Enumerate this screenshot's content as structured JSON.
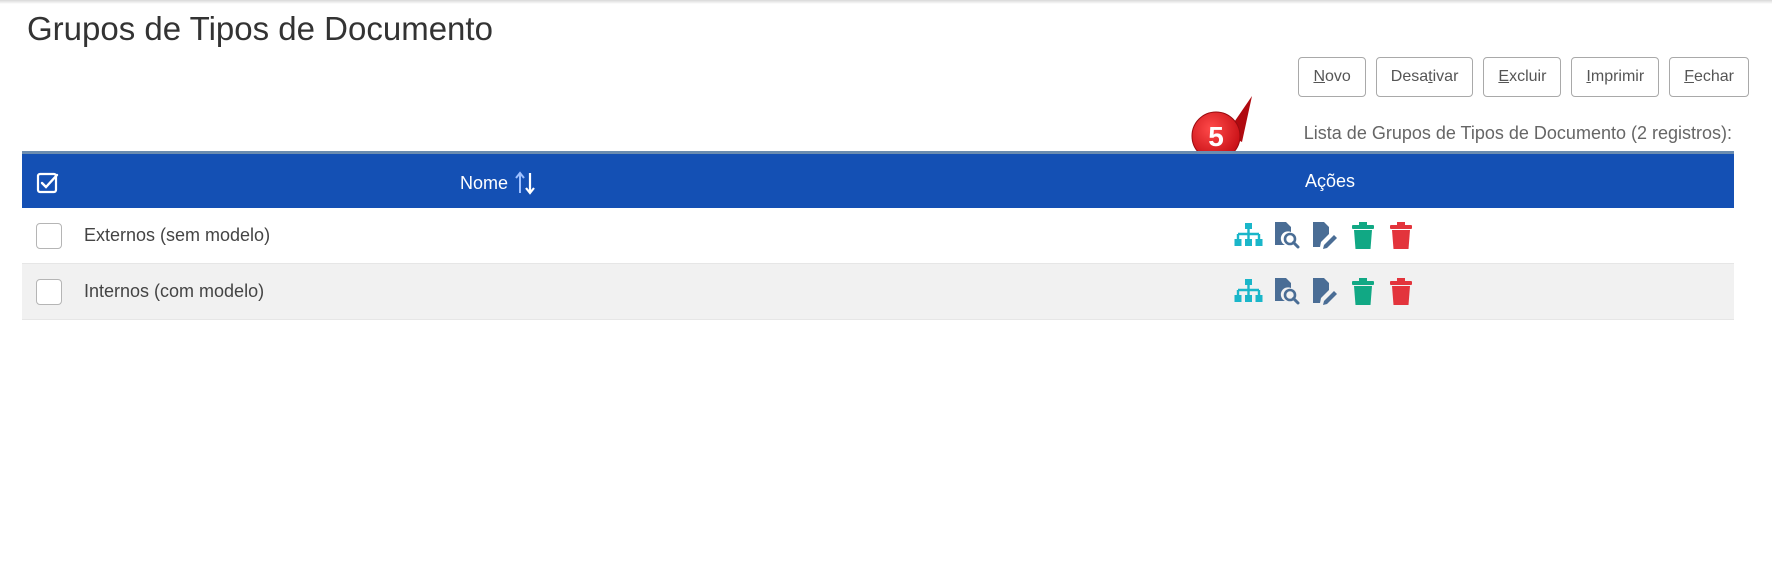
{
  "page": {
    "title": "Grupos de Tipos de Documento"
  },
  "toolbar": {
    "novo": {
      "pre": "",
      "key": "N",
      "post": "ovo"
    },
    "desativar": {
      "pre": "Desa",
      "key": "t",
      "post": "ivar"
    },
    "excluir": {
      "pre": "",
      "key": "E",
      "post": "xcluir"
    },
    "imprimir": {
      "pre": "",
      "key": "I",
      "post": "mprimir"
    },
    "fechar": {
      "pre": "",
      "key": "F",
      "post": "echar"
    }
  },
  "callout": {
    "number": "5",
    "color": "#e0121b"
  },
  "list": {
    "caption": "Lista de Grupos de Tipos de Documento (2 registros):",
    "header": {
      "name": "Nome",
      "actions": "Ações",
      "sort_icon": "sort-arrows-icon",
      "select_all_icon": "check-square-icon"
    },
    "header_color": "#1450b4",
    "rows": [
      {
        "name": "Externos (sem modelo)"
      },
      {
        "name": "Internos (com modelo)"
      }
    ],
    "action_icons": [
      {
        "name": "hierarchy-icon",
        "color": "#1ab6c9"
      },
      {
        "name": "document-search-icon",
        "color": "#4a6d95"
      },
      {
        "name": "edit-document-icon",
        "color": "#4a6d95"
      },
      {
        "name": "trash-icon",
        "color": "#11a884"
      },
      {
        "name": "trash-icon",
        "color": "#e3343c"
      }
    ]
  }
}
